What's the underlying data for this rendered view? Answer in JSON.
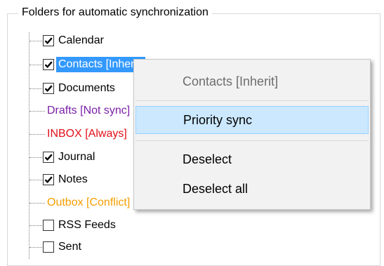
{
  "group_title": "Folders for automatic synchronization",
  "tree": {
    "items": [
      {
        "label": "Calendar",
        "checked": true
      },
      {
        "label": "Contacts [Inherit]",
        "checked": true
      },
      {
        "label": "Documents",
        "checked": true
      },
      {
        "label": "Drafts [Not sync]",
        "checked": false
      },
      {
        "label": "INBOX [Always]",
        "checked": false
      },
      {
        "label": "Journal",
        "checked": true
      },
      {
        "label": "Notes",
        "checked": true
      },
      {
        "label": "Outbox [Conflict]",
        "checked": false
      },
      {
        "label": "RSS Feeds",
        "checked": false
      },
      {
        "label": "Sent",
        "checked": false
      }
    ]
  },
  "context_menu": {
    "header": "Contacts [Inherit]",
    "priority_sync": "Priority sync",
    "deselect": "Deselect",
    "deselect_all": "Deselect all"
  },
  "colors": {
    "selection": "#3399ff",
    "drafts": "#7a1fa8",
    "inbox": "#e0101a",
    "outbox": "#f59f00",
    "menu_highlight": "#cce8ff"
  }
}
